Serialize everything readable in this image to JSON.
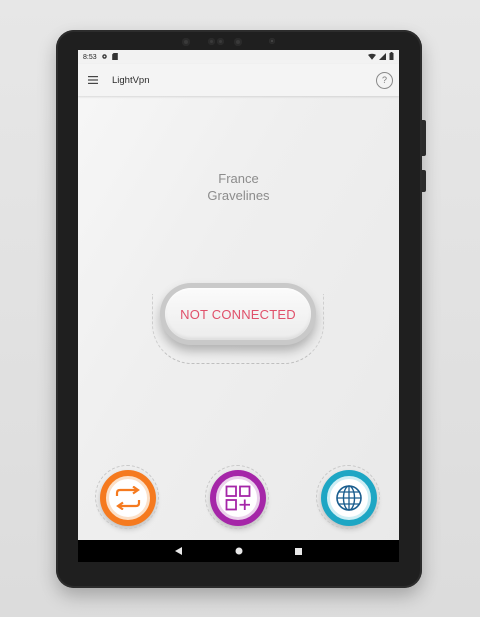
{
  "status_bar": {
    "time": "8:53"
  },
  "app_bar": {
    "title": "LightVpn",
    "help_label": "?"
  },
  "server": {
    "country": "France",
    "city": "Gravelines"
  },
  "connection": {
    "status_label": "NOT CONNECTED",
    "status_color": "#e0506a"
  },
  "actions": [
    {
      "name": "switch-server",
      "icon": "swap-arrows-icon",
      "color": "#f57a1f"
    },
    {
      "name": "apps",
      "icon": "grid-plus-icon",
      "color": "#a526a8"
    },
    {
      "name": "servers",
      "icon": "globe-icon",
      "color": "#1da6c4"
    }
  ],
  "nav": {
    "back": "back-icon",
    "home": "home-icon",
    "recents": "recents-icon"
  }
}
